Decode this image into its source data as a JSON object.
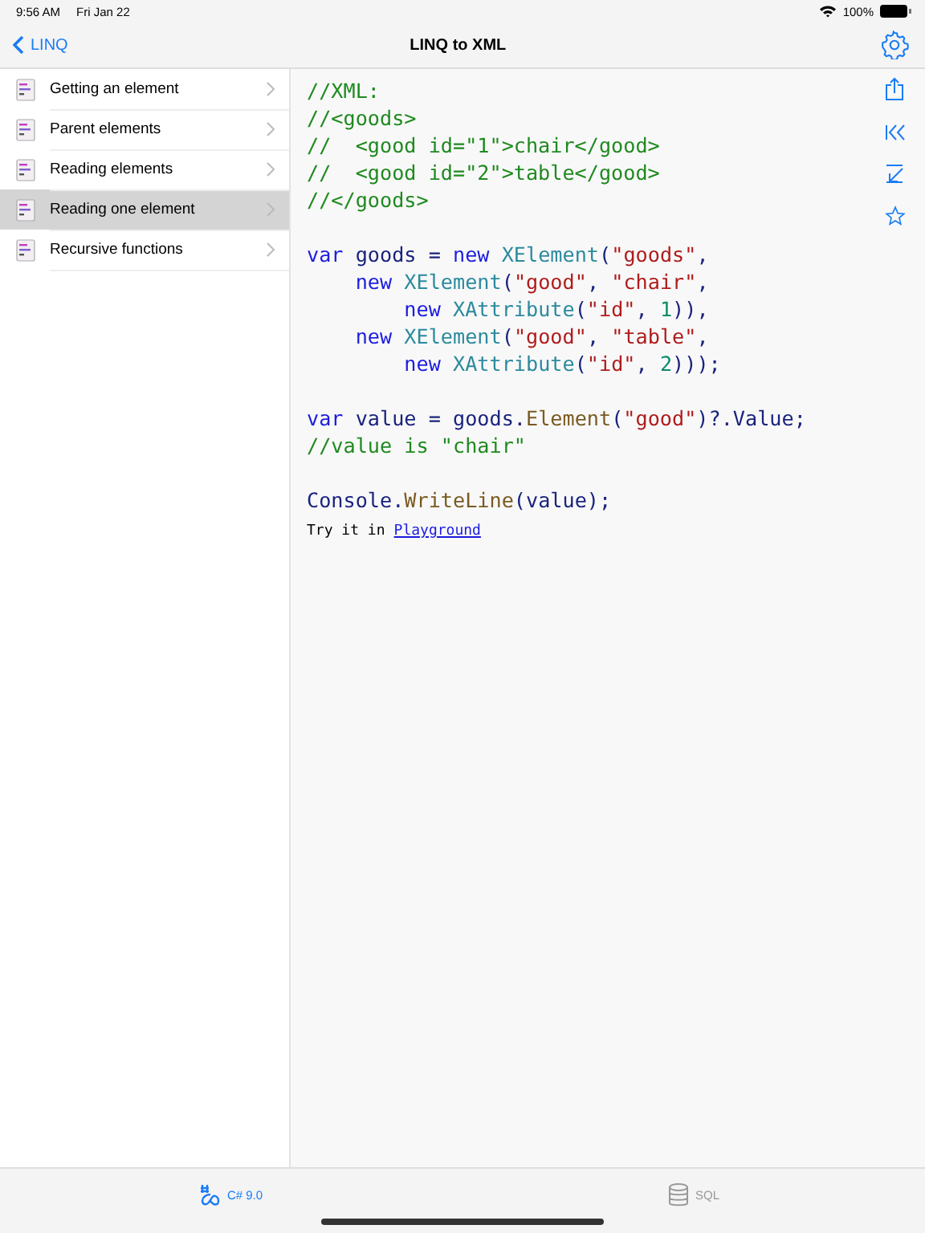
{
  "status_bar": {
    "time": "9:56 AM",
    "date": "Fri Jan 22",
    "battery": "100%"
  },
  "nav": {
    "back": "LINQ",
    "title": "LINQ to XML"
  },
  "sidebar": {
    "items": [
      {
        "label": "Getting an element",
        "selected": false
      },
      {
        "label": "Parent elements",
        "selected": false
      },
      {
        "label": "Reading elements",
        "selected": false
      },
      {
        "label": "Reading one element",
        "selected": true
      },
      {
        "label": "Recursive functions",
        "selected": false
      }
    ]
  },
  "code": [
    {
      "kind": "code",
      "tokens": [
        {
          "text": "//XML:",
          "kind": "comment"
        }
      ]
    },
    {
      "kind": "code",
      "tokens": [
        {
          "text": "//<goods>",
          "kind": "comment"
        }
      ]
    },
    {
      "kind": "code",
      "tokens": [
        {
          "text": "//  <good id=\"1\">chair</good>",
          "kind": "comment"
        }
      ]
    },
    {
      "kind": "code",
      "tokens": [
        {
          "text": "//  <good id=\"2\">table</good>",
          "kind": "comment"
        }
      ]
    },
    {
      "kind": "code",
      "tokens": [
        {
          "text": "//</goods>",
          "kind": "comment"
        }
      ]
    },
    {
      "kind": "blank"
    },
    {
      "kind": "code",
      "tokens": [
        {
          "text": "var",
          "kind": "keyword"
        },
        {
          "text": " goods = ",
          "kind": "plain"
        },
        {
          "text": "new ",
          "kind": "keyword"
        },
        {
          "text": "XElement",
          "kind": "type"
        },
        {
          "text": "(",
          "kind": "plain"
        },
        {
          "text": "\"goods\"",
          "kind": "string"
        },
        {
          "text": ",",
          "kind": "plain"
        }
      ]
    },
    {
      "kind": "code",
      "tokens": [
        {
          "text": "    new ",
          "kind": "keyword"
        },
        {
          "text": "XElement",
          "kind": "type"
        },
        {
          "text": "(",
          "kind": "plain"
        },
        {
          "text": "\"good\"",
          "kind": "string"
        },
        {
          "text": ", ",
          "kind": "plain"
        },
        {
          "text": "\"chair\"",
          "kind": "string"
        },
        {
          "text": ",",
          "kind": "plain"
        }
      ]
    },
    {
      "kind": "code",
      "tokens": [
        {
          "text": "        new ",
          "kind": "keyword"
        },
        {
          "text": "XAttribute",
          "kind": "type"
        },
        {
          "text": "(",
          "kind": "plain"
        },
        {
          "text": "\"id\"",
          "kind": "string"
        },
        {
          "text": ", ",
          "kind": "plain"
        },
        {
          "text": "1",
          "kind": "number"
        },
        {
          "text": ")),",
          "kind": "plain"
        }
      ]
    },
    {
      "kind": "code",
      "tokens": [
        {
          "text": "    new ",
          "kind": "keyword"
        },
        {
          "text": "XElement",
          "kind": "type"
        },
        {
          "text": "(",
          "kind": "plain"
        },
        {
          "text": "\"good\"",
          "kind": "string"
        },
        {
          "text": ", ",
          "kind": "plain"
        },
        {
          "text": "\"table\"",
          "kind": "string"
        },
        {
          "text": ",",
          "kind": "plain"
        }
      ]
    },
    {
      "kind": "code",
      "tokens": [
        {
          "text": "        new ",
          "kind": "keyword"
        },
        {
          "text": "XAttribute",
          "kind": "type"
        },
        {
          "text": "(",
          "kind": "plain"
        },
        {
          "text": "\"id\"",
          "kind": "string"
        },
        {
          "text": ", ",
          "kind": "plain"
        },
        {
          "text": "2",
          "kind": "number"
        },
        {
          "text": ")));",
          "kind": "plain"
        }
      ]
    },
    {
      "kind": "blank"
    },
    {
      "kind": "code",
      "tokens": [
        {
          "text": "var",
          "kind": "keyword"
        },
        {
          "text": " value = goods.",
          "kind": "plain"
        },
        {
          "text": "Element",
          "kind": "method"
        },
        {
          "text": "(",
          "kind": "plain"
        },
        {
          "text": "\"good\"",
          "kind": "string"
        },
        {
          "text": ")?.Value;",
          "kind": "plain"
        }
      ]
    },
    {
      "kind": "code",
      "tokens": [
        {
          "text": "//value is \"chair\"",
          "kind": "comment"
        }
      ]
    },
    {
      "kind": "blank"
    },
    {
      "kind": "code",
      "tokens": [
        {
          "text": "Console.",
          "kind": "plain"
        },
        {
          "text": "WriteLine",
          "kind": "method"
        },
        {
          "text": "(value);",
          "kind": "plain"
        }
      ]
    }
  ],
  "try_text": "Try it in",
  "try_link": "Playground",
  "tabs": [
    {
      "label": "C# 9.0",
      "selected": true
    },
    {
      "label": "SQL",
      "selected": false
    }
  ]
}
